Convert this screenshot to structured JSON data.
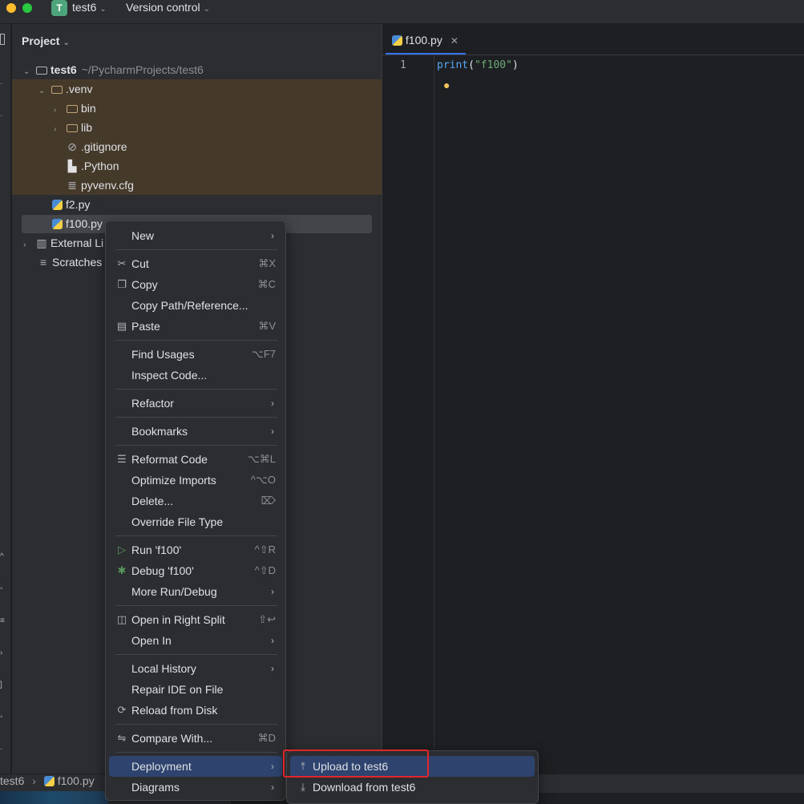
{
  "titlebar": {
    "project_badge": "T",
    "project_name": "test6",
    "vcs_label": "Version control"
  },
  "project_panel": {
    "header": "Project",
    "root": {
      "name": "test6",
      "path": "~/PycharmProjects/test6"
    },
    "items": [
      {
        "label": ".venv"
      },
      {
        "label": "bin"
      },
      {
        "label": "lib"
      },
      {
        "label": ".gitignore"
      },
      {
        "label": ".Python"
      },
      {
        "label": "pyvenv.cfg"
      },
      {
        "label": "f2.py"
      },
      {
        "label": "f100.py"
      },
      {
        "label": "External Li"
      },
      {
        "label": "Scratches"
      }
    ]
  },
  "editor": {
    "tab_label": "f100.py",
    "line_number": "1",
    "code": {
      "fn": "print",
      "open": "(",
      "str": "\"f100\"",
      "close": ")"
    }
  },
  "context_menu": {
    "items": [
      {
        "label": "New",
        "shortcut": ""
      },
      {
        "label": "Cut",
        "shortcut": "⌘X"
      },
      {
        "label": "Copy",
        "shortcut": "⌘C"
      },
      {
        "label": "Copy Path/Reference...",
        "shortcut": ""
      },
      {
        "label": "Paste",
        "shortcut": "⌘V"
      },
      {
        "label": "Find Usages",
        "shortcut": "⌥F7"
      },
      {
        "label": "Inspect Code...",
        "shortcut": ""
      },
      {
        "label": "Refactor",
        "shortcut": ""
      },
      {
        "label": "Bookmarks",
        "shortcut": ""
      },
      {
        "label": "Reformat Code",
        "shortcut": "⌥⌘L"
      },
      {
        "label": "Optimize Imports",
        "shortcut": "^⌥O"
      },
      {
        "label": "Delete...",
        "shortcut": "⌦"
      },
      {
        "label": "Override File Type",
        "shortcut": ""
      },
      {
        "label": "Run 'f100'",
        "shortcut": "^⇧R"
      },
      {
        "label": "Debug 'f100'",
        "shortcut": "^⇧D"
      },
      {
        "label": "More Run/Debug",
        "shortcut": ""
      },
      {
        "label": "Open in Right Split",
        "shortcut": "⇧↩"
      },
      {
        "label": "Open In",
        "shortcut": ""
      },
      {
        "label": "Local History",
        "shortcut": ""
      },
      {
        "label": "Repair IDE on File",
        "shortcut": ""
      },
      {
        "label": "Reload from Disk",
        "shortcut": ""
      },
      {
        "label": "Compare With...",
        "shortcut": "⌘D"
      },
      {
        "label": "Deployment",
        "shortcut": ""
      },
      {
        "label": "Diagrams",
        "shortcut": ""
      }
    ]
  },
  "submenu": {
    "items": [
      {
        "label": "Upload to test6"
      },
      {
        "label": "Download from test6"
      }
    ]
  },
  "statusbar": {
    "crumb_project": "test6",
    "crumb_file": "f100.py"
  },
  "colors": {
    "menu_active": "#2e436e",
    "highlight_box": "#e0262b",
    "venv_bg": "#45392a"
  }
}
